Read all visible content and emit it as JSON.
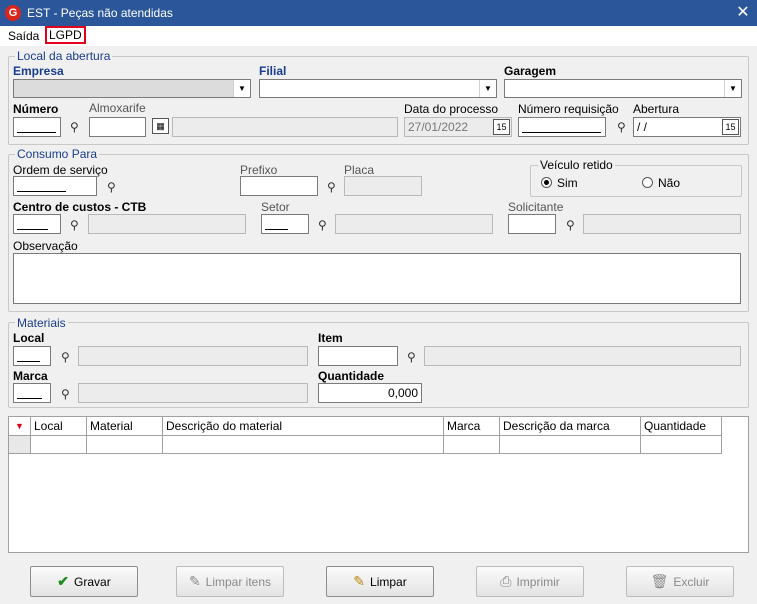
{
  "window": {
    "title": "EST - Peças não atendidas",
    "logo": "G",
    "close_glyph": "✕"
  },
  "menu": {
    "items": [
      "Saída",
      "LGPD"
    ]
  },
  "sections": {
    "abertura": {
      "legend": "Local da abertura",
      "empresa": "Empresa",
      "filial": "Filial",
      "garagem": "Garagem",
      "numero": "Número",
      "almoxarife": "Almoxarife",
      "data_processo": "Data do processo",
      "data_processo_value": "27/01/2022",
      "numero_requisicao": "Número requisição",
      "abertura": "Abertura",
      "abertura_value": " / /"
    },
    "consumo": {
      "legend": "Consumo Para",
      "ordem_servico": "Ordem de serviço",
      "prefixo": "Prefixo",
      "placa": "Placa",
      "veiculo_retido": "Veículo retido",
      "sim": "Sim",
      "nao": "Não",
      "centro_custos": "Centro de custos - CTB",
      "setor": "Setor",
      "solicitante": "Solicitante",
      "observacao": "Observação"
    },
    "materiais": {
      "legend": "Materiais",
      "local": "Local",
      "item": "Item",
      "marca": "Marca",
      "quantidade": "Quantidade",
      "quantidade_value": "0,000"
    }
  },
  "grid": {
    "columns": [
      "Local",
      "Material",
      "Descrição do material",
      "Marca",
      "Descrição da marca",
      "Quantidade"
    ]
  },
  "buttons": {
    "gravar": "Gravar",
    "limpar_itens": "Limpar itens",
    "limpar": "Limpar",
    "imprimir": "Imprimir",
    "excluir": "Excluir"
  },
  "icons": {
    "binoculars": "binoculars-icon",
    "calendar": "calendar-icon"
  },
  "colors": {
    "titlebar": "#2b579a",
    "highlight": "#e3001b",
    "label_blue": "#1a3c8c"
  }
}
